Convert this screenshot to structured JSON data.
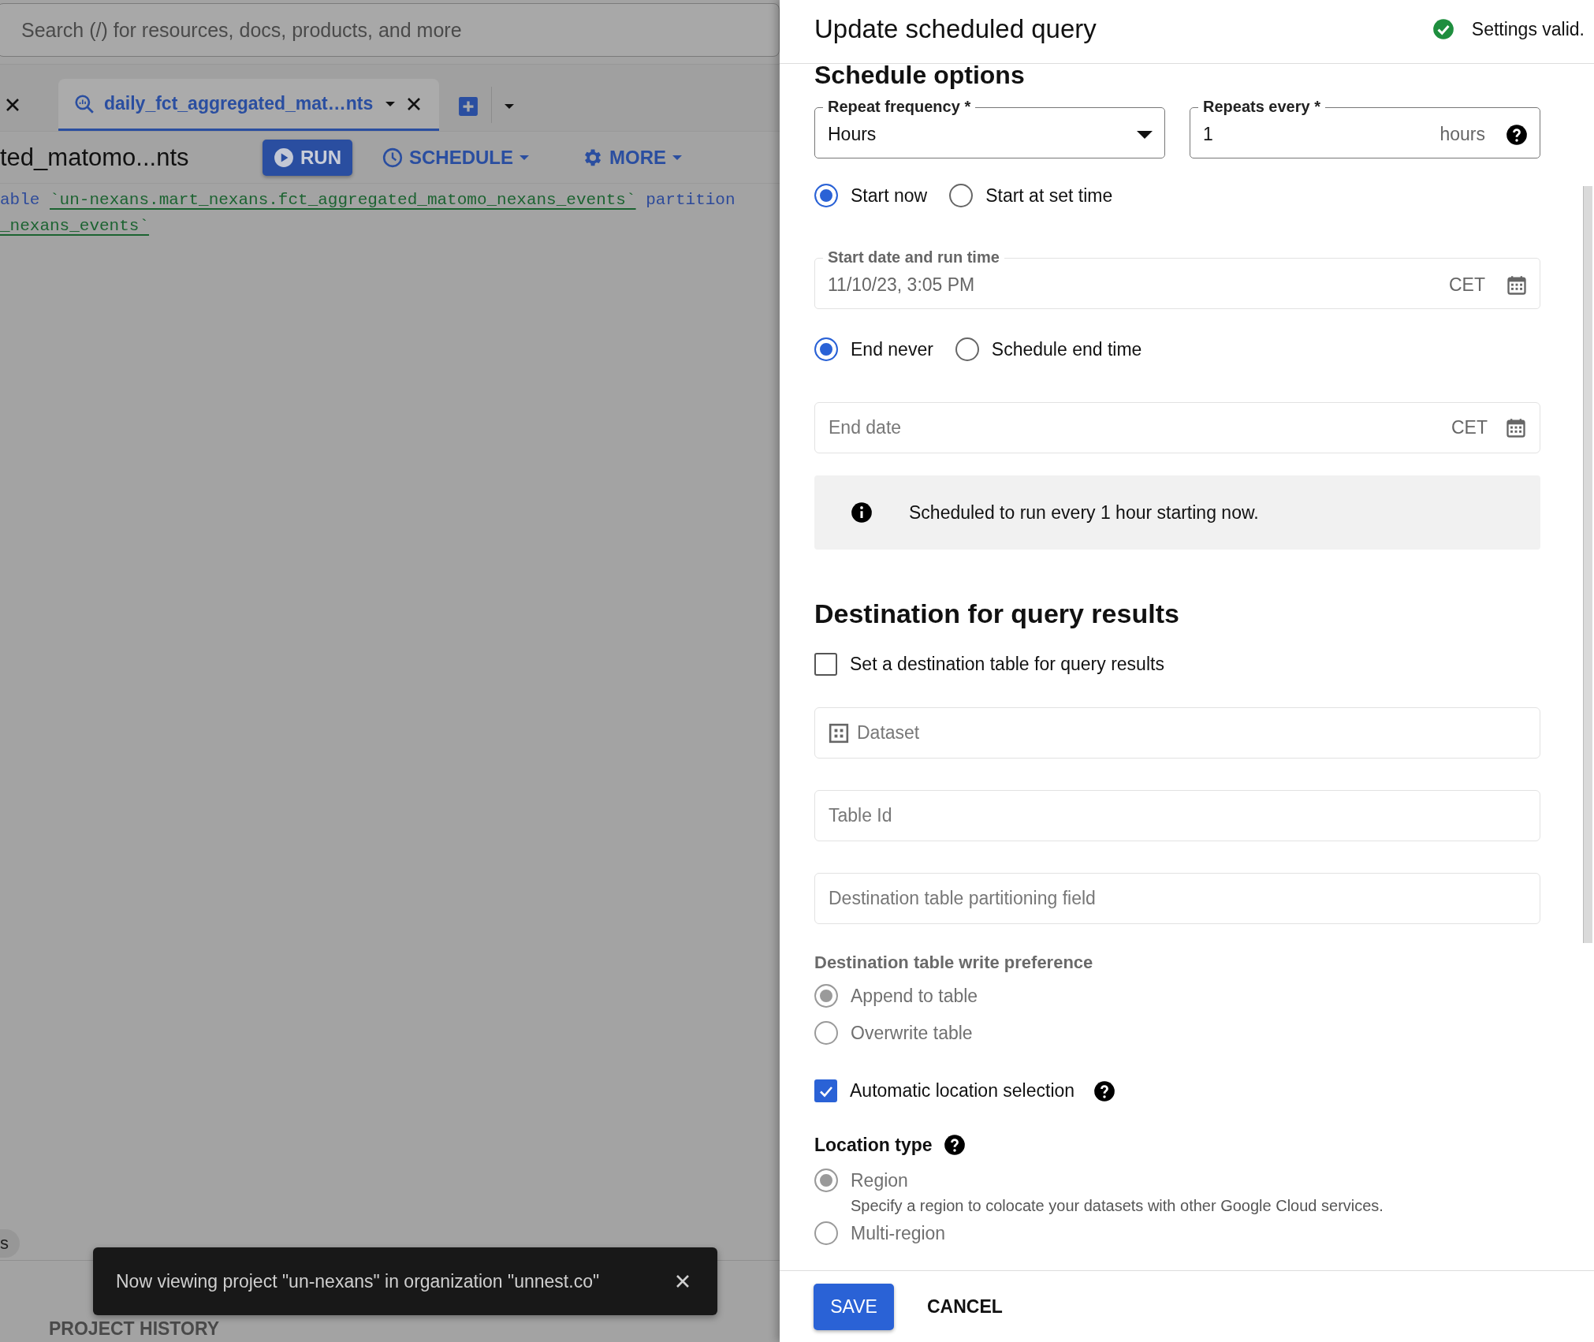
{
  "search": {
    "placeholder": "Search (/) for resources, docs, products, and more"
  },
  "editor_tabs": [
    {
      "label": "daily_fct_aggregated_mat…nts",
      "selected": true
    }
  ],
  "query_title": "ted_matomo...nts",
  "toolbar": [
    {
      "label": "RUN",
      "kind": "primary"
    },
    {
      "label": "SCHEDULE",
      "kind": "schedule"
    },
    {
      "label": "MORE",
      "kind": "more"
    }
  ],
  "code_lines": [
    [
      {
        "text": "able ",
        "kind": "keyword"
      },
      {
        "text": "`un-nexans.mart_nexans.fct_aggregated_matomo_nexans_events`",
        "kind": "table"
      },
      {
        "text": " partition",
        "kind": "keyword"
      }
    ],
    [
      {
        "text": "_nexans_events`",
        "kind": "table"
      }
    ]
  ],
  "chip": "s",
  "bottom_tab": "PROJECT HISTORY",
  "toast": {
    "message": "Now viewing project \"un-nexans\" in organization \"unnest.co\""
  },
  "panel": {
    "title": "Update scheduled query",
    "status": {
      "text": "Settings valid.",
      "valid": true
    },
    "schedule_heading": "Schedule options",
    "repeat_frequency": {
      "label": "Repeat frequency *",
      "value": "Hours"
    },
    "repeats_every": {
      "label": "Repeats every *",
      "value": "1",
      "suffix": "hours"
    },
    "start_options": [
      {
        "label": "Start now",
        "selected": true
      },
      {
        "label": "Start at set time",
        "selected": false
      }
    ],
    "start_date": {
      "label": "Start date and run time",
      "value": "11/10/23, 3:05 PM",
      "timezone": "CET",
      "disabled": true
    },
    "end_options": [
      {
        "label": "End never",
        "selected": true
      },
      {
        "label": "Schedule end time",
        "selected": false
      }
    ],
    "end_date": {
      "placeholder": "End date",
      "timezone": "CET"
    },
    "info": "Scheduled to run every 1 hour starting now.",
    "destination_heading": "Destination for query results",
    "destination_checkbox": {
      "label": "Set a destination table for query results",
      "checked": false
    },
    "destination_fields": [
      {
        "placeholder": "Dataset",
        "kind": "dataset"
      },
      {
        "placeholder": "Table Id",
        "kind": "text"
      },
      {
        "placeholder": "Destination table partitioning field",
        "kind": "text"
      }
    ],
    "write_preference": {
      "label": "Destination table write preference",
      "options": [
        {
          "label": "Append to table",
          "selected": true,
          "disabled": true
        },
        {
          "label": "Overwrite table",
          "selected": false,
          "disabled": true
        }
      ]
    },
    "auto_location": {
      "label": "Automatic location selection",
      "checked": true
    },
    "location_type": {
      "label": "Location type",
      "options": [
        {
          "label": "Region",
          "description": "Specify a region to colocate your datasets with other Google Cloud services.",
          "selected": true,
          "disabled": true
        },
        {
          "label": "Multi-region",
          "selected": false,
          "disabled": true
        }
      ]
    },
    "buttons": [
      {
        "label": "SAVE",
        "kind": "primary"
      },
      {
        "label": "CANCEL",
        "kind": "text"
      }
    ]
  }
}
